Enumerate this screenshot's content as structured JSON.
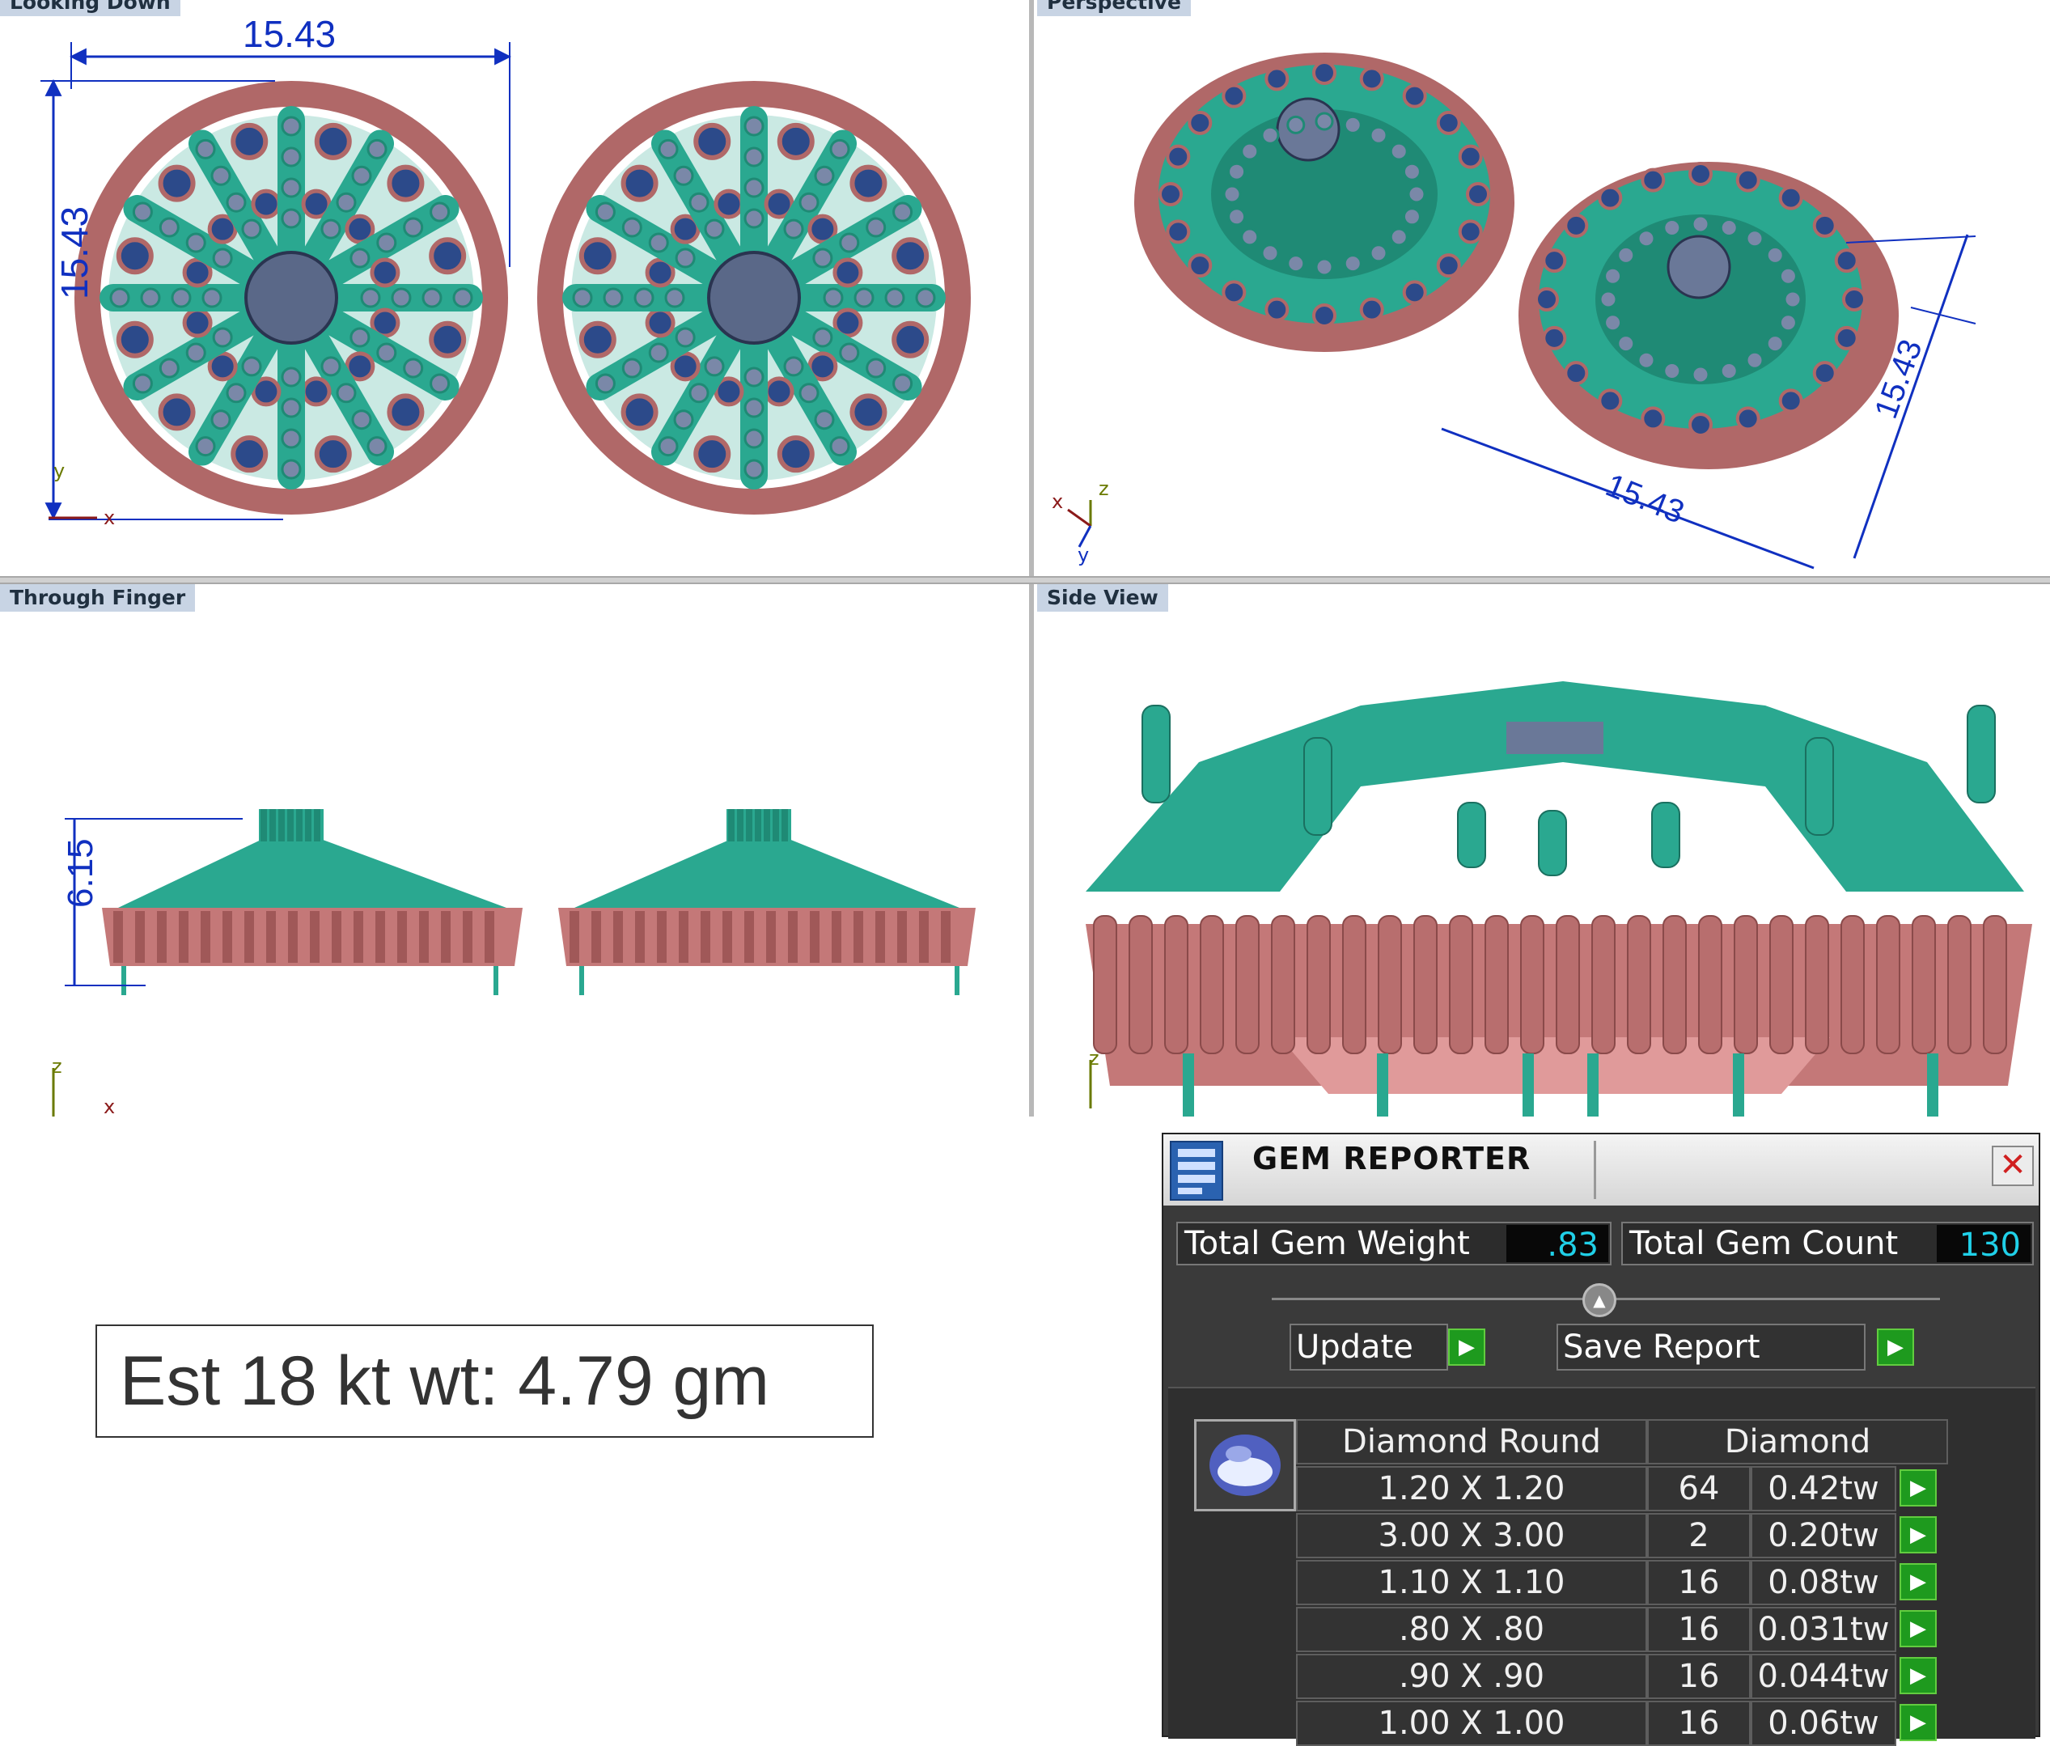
{
  "viewports": {
    "top_left": {
      "label": "Looking Down",
      "dim_horizontal": "15.43",
      "dim_vertical": "15.43",
      "axis_x": "x",
      "axis_y": "y"
    },
    "top_right": {
      "label": "Perspective",
      "dim_a": "15.43",
      "dim_b": "15.43",
      "axis_x": "x",
      "axis_y": "y",
      "axis_z": "z"
    },
    "bottom_left": {
      "label": "Through Finger",
      "dim_height": "6.15",
      "axis_x": "x",
      "axis_z": "z"
    },
    "bottom_right": {
      "label": "Side View",
      "axis_z": "z"
    }
  },
  "estimate": {
    "text": "Est 18 kt wt: 4.79 gm"
  },
  "gem_reporter": {
    "title": "GEM REPORTER",
    "close_glyph": "✕",
    "total_weight_label": "Total Gem Weight",
    "total_weight_value": ".83",
    "total_count_label": "Total Gem Count",
    "total_count_value": "130",
    "update_label": "Update",
    "save_label": "Save Report",
    "header_shape": "Diamond Round",
    "header_material": "Diamond",
    "rows": [
      {
        "size": "1.20 X 1.20",
        "count": "64",
        "weight": "0.42tw"
      },
      {
        "size": "3.00 X 3.00",
        "count": "2",
        "weight": "0.20tw"
      },
      {
        "size": "1.10 X 1.10",
        "count": "16",
        "weight": "0.08tw"
      },
      {
        "size": ".80 X .80",
        "count": "16",
        "weight": "0.031tw"
      },
      {
        "size": ".90 X .90",
        "count": "16",
        "weight": "0.044tw"
      },
      {
        "size": "1.00 X 1.00",
        "count": "16",
        "weight": "0.06tw"
      }
    ]
  },
  "colors": {
    "metal_teal": "#2aa890",
    "metal_rose": "#b06868",
    "gem_blue": "#2c4a8a",
    "gem_grey": "#7a88a8",
    "dimension": "#1030c0"
  }
}
